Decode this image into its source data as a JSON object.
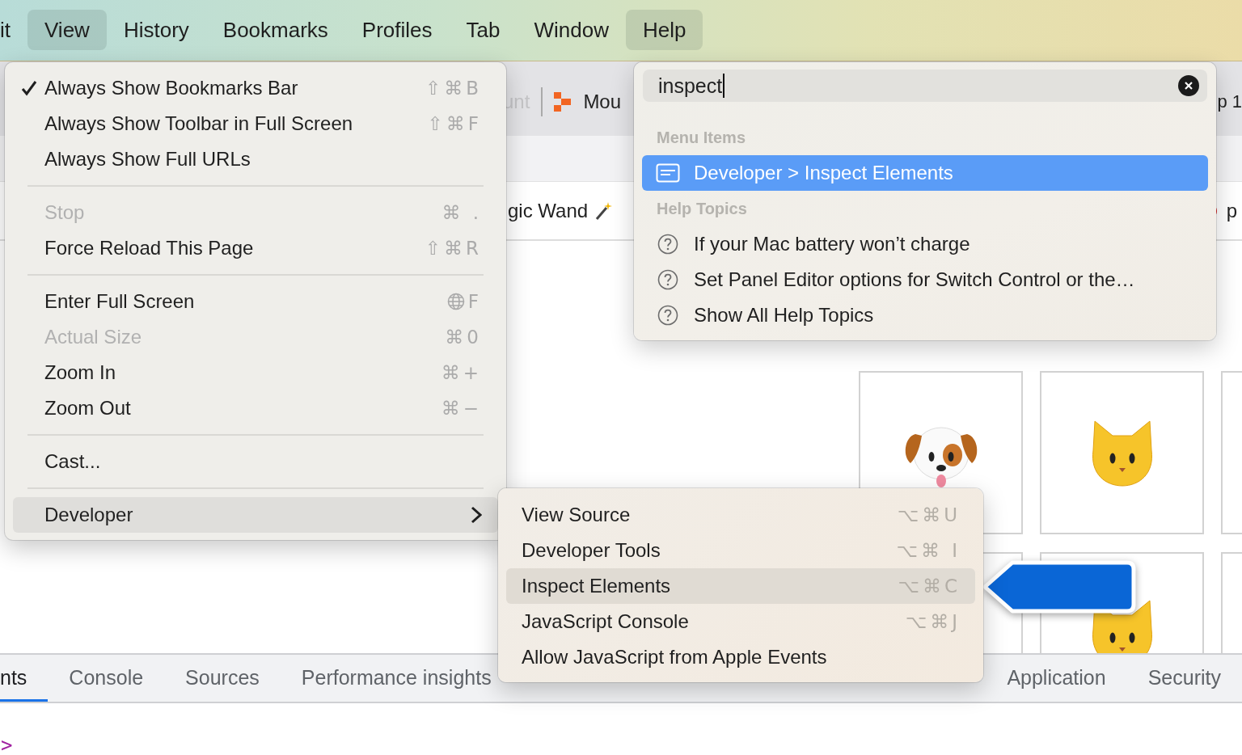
{
  "menu_bar": {
    "items": [
      {
        "label": "it",
        "selected": false
      },
      {
        "label": "View",
        "selected": true
      },
      {
        "label": "History",
        "selected": false
      },
      {
        "label": "Bookmarks",
        "selected": false
      },
      {
        "label": "Profiles",
        "selected": false
      },
      {
        "label": "Tab",
        "selected": false
      },
      {
        "label": "Window",
        "selected": false
      },
      {
        "label": "Help",
        "selected": true
      }
    ]
  },
  "bookmarks_bar": {
    "items": [
      {
        "label": "unt",
        "dimmed": true,
        "icon": false
      },
      {
        "label": "Mou",
        "dimmed": false,
        "icon": true
      }
    ],
    "right_item": "p 1"
  },
  "page_row": {
    "left_text": "gic Wand",
    "right_text": "p"
  },
  "tiles": [
    {
      "kind": "dog"
    },
    {
      "kind": "cat"
    },
    {
      "kind": "blank"
    },
    {
      "kind": "blank"
    },
    {
      "kind": "cat"
    },
    {
      "kind": "blank"
    }
  ],
  "devtools": {
    "tabs": [
      {
        "label": "nts",
        "selected": true
      },
      {
        "label": "Console",
        "selected": false
      },
      {
        "label": "Sources",
        "selected": false
      },
      {
        "label": "Performance insights",
        "selected": false
      },
      {
        "label": "Application",
        "selected": false
      },
      {
        "label": "Security",
        "selected": false
      }
    ],
    "console_prompt": ">"
  },
  "view_menu": {
    "items": [
      {
        "kind": "item",
        "label": "Always Show Bookmarks Bar",
        "shortcut": "⇧⌘B",
        "checked": true,
        "disabled": false
      },
      {
        "kind": "item",
        "label": "Always Show Toolbar in Full Screen",
        "shortcut": "⇧⌘F",
        "checked": false,
        "disabled": false
      },
      {
        "kind": "item",
        "label": "Always Show Full URLs",
        "checked": false,
        "disabled": false
      },
      {
        "kind": "separator"
      },
      {
        "kind": "item",
        "label": "Stop",
        "shortcut": "⌘ .",
        "checked": false,
        "disabled": true
      },
      {
        "kind": "item",
        "label": "Force Reload This Page",
        "shortcut": "⇧⌘R",
        "checked": false,
        "disabled": false
      },
      {
        "kind": "separator"
      },
      {
        "kind": "globe_item",
        "label": "Enter Full Screen",
        "shortcut": "F",
        "checked": false,
        "disabled": false
      },
      {
        "kind": "item",
        "label": "Actual Size",
        "shortcut": "⌘0",
        "checked": false,
        "disabled": true
      },
      {
        "kind": "item",
        "label": "Zoom In",
        "shortcut": "⌘+",
        "checked": false,
        "disabled": false
      },
      {
        "kind": "item",
        "label": "Zoom Out",
        "shortcut": "⌘−",
        "checked": false,
        "disabled": false
      },
      {
        "kind": "separator"
      },
      {
        "kind": "item",
        "label": "Cast...",
        "checked": false,
        "disabled": false
      },
      {
        "kind": "separator"
      },
      {
        "kind": "submenu",
        "label": "Developer",
        "checked": false,
        "disabled": false,
        "selected": true
      }
    ]
  },
  "developer_submenu": {
    "items": [
      {
        "label": "View Source",
        "shortcut": "⌥⌘U",
        "selected": false
      },
      {
        "label": "Developer Tools",
        "shortcut": "⌥⌘ I",
        "selected": false
      },
      {
        "label": "Inspect Elements",
        "shortcut": "⌥⌘C",
        "selected": true
      },
      {
        "label": "JavaScript Console",
        "shortcut": "⌥⌘J",
        "selected": false
      },
      {
        "label": "Allow JavaScript from Apple Events",
        "selected": false
      }
    ]
  },
  "help_menu": {
    "search": {
      "value": "inspect"
    },
    "sections": [
      {
        "header": "Menu Items",
        "items": [
          {
            "kind": "menu",
            "label": "Developer > Inspect Elements",
            "selected": true
          }
        ]
      },
      {
        "header": "Help Topics",
        "items": [
          {
            "kind": "help",
            "label": "If your Mac battery won’t charge",
            "selected": false
          },
          {
            "kind": "help",
            "label": "Set Panel Editor options for Switch Control or the…",
            "selected": false
          },
          {
            "kind": "help",
            "label": "Show All Help Topics",
            "selected": false
          }
        ]
      }
    ]
  }
}
